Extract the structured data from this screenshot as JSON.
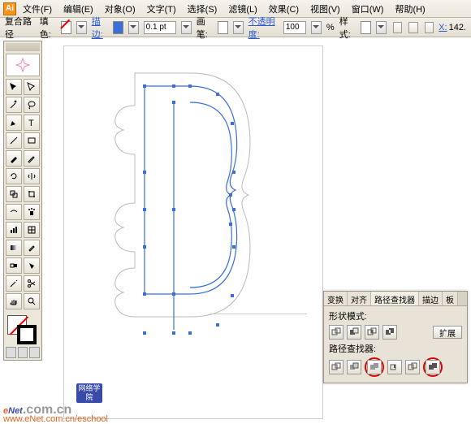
{
  "menu": {
    "items": [
      "文件(F)",
      "编辑(E)",
      "对象(O)",
      "文字(T)",
      "选择(S)",
      "滤镜(L)",
      "效果(C)",
      "视图(V)",
      "窗口(W)",
      "帮助(H)"
    ]
  },
  "options": {
    "pathLabel": "复合路径",
    "fillLabel": "填色:",
    "strokeLabel": "描边:",
    "strokeWeight": "0.1 pt",
    "brushLabel": "画笔:",
    "opacityLabel": "不透明度:",
    "opacityValue": "100",
    "opacityUnit": "%",
    "styleLabel": "样式:",
    "xLabel": "X:",
    "xValue": "142."
  },
  "tools": [
    "selection",
    "direct-selection",
    "magic-wand",
    "lasso",
    "pen",
    "type",
    "line",
    "rectangle",
    "paintbrush",
    "pencil",
    "rotate",
    "reflect",
    "scale",
    "free-transform",
    "warp",
    "symbol-sprayer",
    "column-graph",
    "mesh",
    "gradient",
    "eyedropper",
    "blend",
    "live-paint",
    "slice",
    "scissors",
    "hand",
    "zoom"
  ],
  "panel": {
    "tabs": [
      "变换",
      "对齐",
      "路径查找器",
      "描边",
      "板"
    ],
    "shapeModeLabel": "形状模式:",
    "pathfinderLabel": "路径查找器:",
    "expandLabel": "扩展",
    "shapeModes": [
      "add",
      "subtract",
      "intersect",
      "exclude"
    ],
    "pathfinders": [
      "divide",
      "trim",
      "merge",
      "crop",
      "outline",
      "minus-back"
    ]
  },
  "watermark": {
    "e": "e",
    "net": "Net",
    "comcn": ".com.cn",
    "sub": "www.eNet.com.cn/eschool",
    "credit": "网络学院"
  }
}
